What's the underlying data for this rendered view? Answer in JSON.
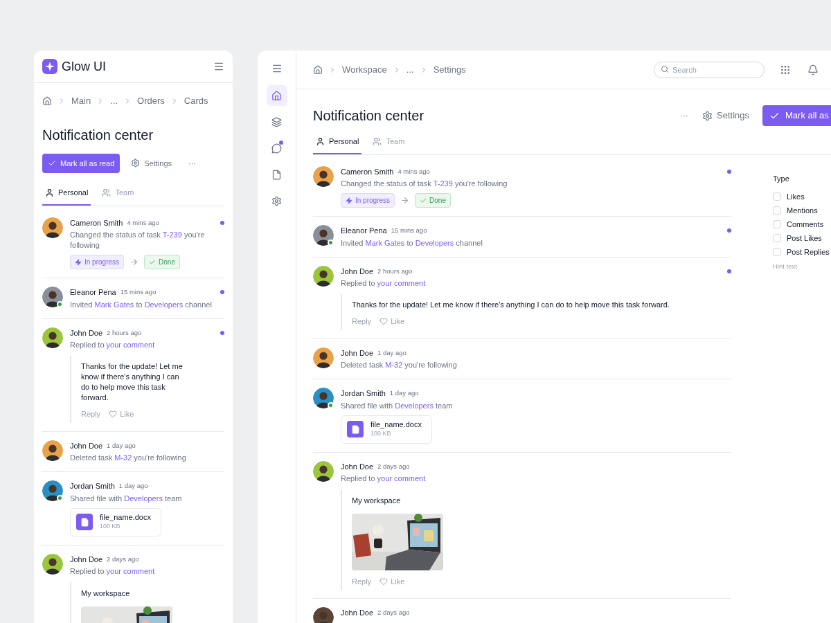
{
  "mobile": {
    "brand": "Glow UI",
    "breadcrumb": [
      "Main",
      "...",
      "Orders",
      "Cards"
    ],
    "title": "Notification center",
    "mark_all": "Mark all as read",
    "settings": "Settings",
    "more": "···",
    "tabs": [
      {
        "label": "Personal",
        "kind": "person",
        "selected": true
      },
      {
        "label": "Team",
        "kind": "team",
        "selected": false
      }
    ],
    "notifications": [
      {
        "name": "Cameron Smith",
        "time": "4 mins ago",
        "unread": true,
        "online": false,
        "color": "#e8a24a",
        "message": [
          {
            "text": "Changed the status of task ",
            "link": false
          },
          {
            "text": "T-239",
            "link": true
          },
          {
            "text": " you're following",
            "link": false
          }
        ],
        "attachment": {
          "kind": "status",
          "from": "In progress",
          "to": "Done"
        }
      },
      {
        "name": "Eleanor Pena",
        "time": "15 mins ago",
        "unread": true,
        "online": true,
        "color": "#8a8f99",
        "message": [
          {
            "text": "Invited ",
            "link": false
          },
          {
            "text": "Mark Gates",
            "link": true
          },
          {
            "text": " to ",
            "link": false
          },
          {
            "text": "Developers",
            "link": true
          },
          {
            "text": " channel",
            "link": false
          }
        ]
      },
      {
        "name": "John Doe",
        "time": "2 hours ago",
        "unread": true,
        "online": false,
        "color": "#9bc53d",
        "message": [
          {
            "text": "Replied to ",
            "link": false
          },
          {
            "text": "your comment",
            "link": true
          }
        ],
        "attachment": {
          "kind": "comment",
          "text": "Thanks for the update! Let me know if there's anything I can do to help move this task forward.",
          "reply": "Reply",
          "like": "Like"
        }
      },
      {
        "name": "John Doe",
        "time": "1 day ago",
        "unread": false,
        "online": false,
        "color": "#e8a24a",
        "message": [
          {
            "text": "Deleted task ",
            "link": false
          },
          {
            "text": "M-32",
            "link": true
          },
          {
            "text": " you're following",
            "link": false
          }
        ]
      },
      {
        "name": "Jordan Smith",
        "time": "1 day ago",
        "unread": false,
        "online": true,
        "color": "#2a8fc4",
        "message": [
          {
            "text": "Shared file with ",
            "link": false
          },
          {
            "text": "Developers",
            "link": true
          },
          {
            "text": " team",
            "link": false
          }
        ],
        "attachment": {
          "kind": "file",
          "name": "file_name.docx",
          "size": "100 KB"
        }
      },
      {
        "name": "John Doe",
        "time": "2 days ago",
        "unread": false,
        "online": false,
        "color": "#9bc53d",
        "message": [
          {
            "text": "Replied to ",
            "link": false
          },
          {
            "text": "your comment",
            "link": true
          }
        ],
        "attachment": {
          "title": "My workspace"
        }
      }
    ]
  },
  "desktop": {
    "nav": [
      {
        "kind": "home",
        "selected": true,
        "badge": false
      },
      {
        "kind": "layers",
        "selected": false,
        "badge": false
      },
      {
        "kind": "chat",
        "selected": false,
        "badge": true
      },
      {
        "kind": "file",
        "selected": false,
        "badge": false
      },
      {
        "kind": "settings",
        "selected": false,
        "badge": false
      }
    ],
    "breadcrumb": [
      "Workspace",
      "...",
      "Settings"
    ],
    "search": {
      "placeholder": "Search"
    },
    "title": "Notification center",
    "more": "···",
    "settings": "Settings",
    "mark_all": "Mark all as",
    "tabs": [
      {
        "label": "Personal",
        "kind": "person",
        "selected": true
      },
      {
        "label": "Team",
        "kind": "team",
        "selected": false
      }
    ],
    "notifications": [
      {
        "name": "Cameron Smith",
        "time": "4 mins ago",
        "unread": true,
        "online": false,
        "color": "#e8a24a",
        "message": [
          {
            "text": "Changed the status of task ",
            "link": false
          },
          {
            "text": "T-239",
            "link": true
          },
          {
            "text": " you're following",
            "link": false
          }
        ],
        "attachment": {
          "kind": "status",
          "from": "In progress",
          "to": "Done"
        }
      },
      {
        "name": "Eleanor Pena",
        "time": "15 mins ago",
        "unread": true,
        "online": true,
        "color": "#8a8f99",
        "message": [
          {
            "text": "Invited ",
            "link": false
          },
          {
            "text": "Mark Gates",
            "link": true
          },
          {
            "text": " to ",
            "link": false
          },
          {
            "text": "Developers",
            "link": true
          },
          {
            "text": " channel",
            "link": false
          }
        ]
      },
      {
        "name": "John Doe",
        "time": "2 hours ago",
        "unread": true,
        "online": false,
        "color": "#9bc53d",
        "message": [
          {
            "text": "Replied to ",
            "link": false
          },
          {
            "text": "your comment",
            "link": true
          }
        ],
        "attachment": {
          "kind": "comment",
          "text": "Thanks for the update! Let me know if there's anything I can do to help move this task forward.",
          "reply": "Reply",
          "like": "Like"
        }
      },
      {
        "name": "John Doe",
        "time": "1 day ago",
        "unread": false,
        "online": false,
        "color": "#e8a24a",
        "message": [
          {
            "text": "Deleted task ",
            "link": false
          },
          {
            "text": "M-32",
            "link": true
          },
          {
            "text": " you're following",
            "link": false
          }
        ]
      },
      {
        "name": "Jordan Smith",
        "time": "1 day ago",
        "unread": false,
        "online": true,
        "color": "#2a8fc4",
        "message": [
          {
            "text": "Shared file with ",
            "link": false
          },
          {
            "text": "Developers",
            "link": true
          },
          {
            "text": " team",
            "link": false
          }
        ],
        "attachment": {
          "kind": "file",
          "name": "file_name.docx",
          "size": "100 KB"
        }
      },
      {
        "name": "John Doe",
        "time": "2 days ago",
        "unread": false,
        "online": false,
        "color": "#9bc53d",
        "message": [
          {
            "text": "Replied to ",
            "link": false
          },
          {
            "text": "your comment",
            "link": true
          }
        ],
        "attachment": {
          "title": "My workspace",
          "reply": "Reply",
          "like": "Like"
        }
      },
      {
        "name": "John Doe",
        "time": "2 days ago",
        "unread": false,
        "online": false,
        "color": "#5a4636"
      }
    ],
    "filter": {
      "title": "Type",
      "options": [
        {
          "label": "Likes",
          "checked": false
        },
        {
          "label": "Mentions",
          "checked": false
        },
        {
          "label": "Comments",
          "checked": false
        },
        {
          "label": "Post Likes",
          "checked": false
        },
        {
          "label": "Post Replies",
          "checked": false
        }
      ],
      "hint": "Hint text"
    }
  }
}
